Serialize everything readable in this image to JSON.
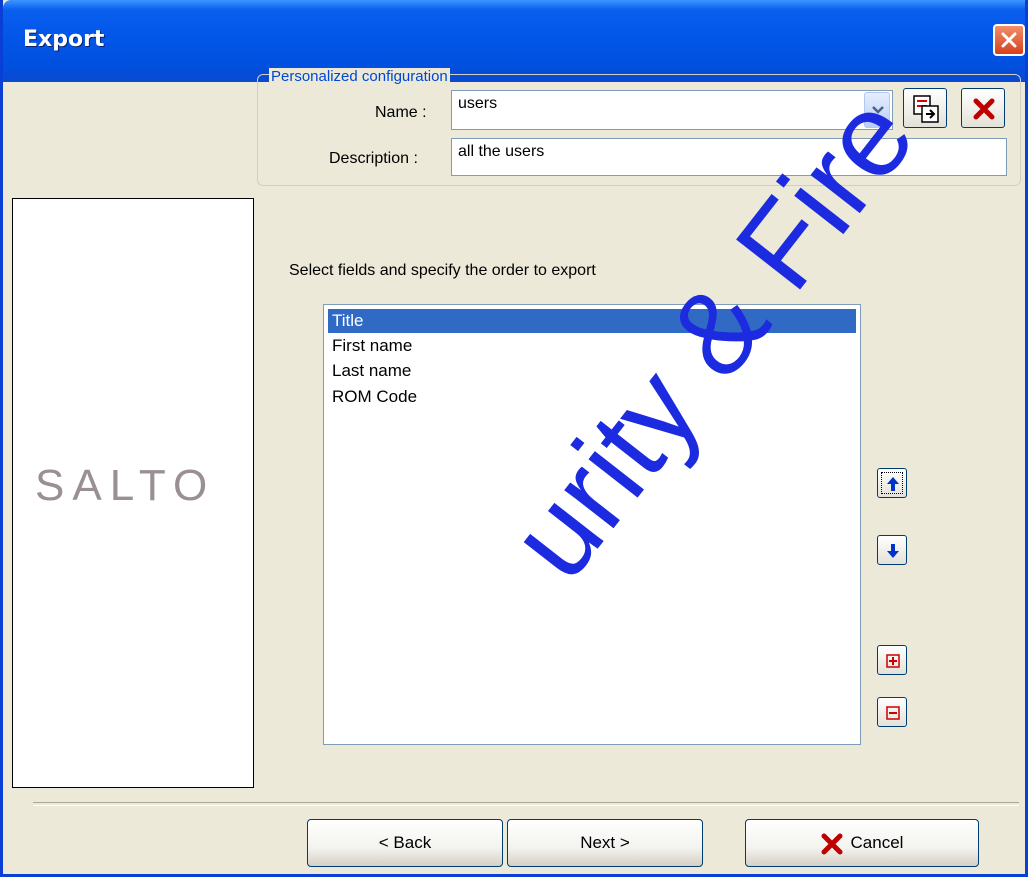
{
  "window": {
    "title": "Export"
  },
  "config": {
    "legend": "Personalized configuration",
    "name_label": "Name :",
    "name_value": "users",
    "description_label": "Description :",
    "description_value": "all the users"
  },
  "logo": {
    "text": "SALTO"
  },
  "fields": {
    "instruction": "Select fields and specify the order to export",
    "items": [
      {
        "label": "Title",
        "selected": true
      },
      {
        "label": "First name",
        "selected": false
      },
      {
        "label": "Last name",
        "selected": false
      },
      {
        "label": "ROM Code",
        "selected": false
      }
    ]
  },
  "side_buttons": [
    {
      "icon": "arrow-up-icon",
      "color": "#0033CC"
    },
    {
      "icon": "arrow-down-icon",
      "color": "#0033CC"
    },
    {
      "icon": "plus-icon",
      "color": "#CC0000"
    },
    {
      "icon": "minus-icon",
      "color": "#CC0000"
    }
  ],
  "footer": {
    "back_label": "< Back",
    "next_label": "Next >",
    "cancel_label": "Cancel"
  },
  "watermark": "urity & Fire"
}
